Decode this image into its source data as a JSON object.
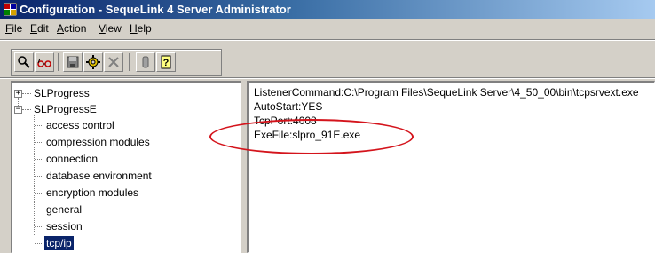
{
  "window": {
    "title": "Configuration - SequeLink 4 Server Administrator"
  },
  "menu": [
    {
      "label": "File",
      "accel": "F",
      "rest": "ile"
    },
    {
      "label": "Edit",
      "accel": "E",
      "rest": "dit"
    },
    {
      "label": "Action",
      "accel": "A",
      "rest": "ction"
    },
    {
      "label": "View",
      "accel": "V",
      "rest": "iew"
    },
    {
      "label": "Help",
      "accel": "H",
      "rest": "elp"
    }
  ],
  "toolbar": {
    "buttons": [
      "search-icon",
      "glasses-icon",
      "save-icon",
      "gear-icon",
      "delete-icon",
      "stop-icon",
      "help-icon"
    ]
  },
  "tree": {
    "nodes": [
      {
        "label": "SLProgress",
        "expander": "+"
      },
      {
        "label": "SLProgressE",
        "expander": "-"
      }
    ],
    "children": [
      {
        "label": "access control"
      },
      {
        "label": "compression modules"
      },
      {
        "label": "connection"
      },
      {
        "label": "database environment"
      },
      {
        "label": "encryption modules"
      },
      {
        "label": "general"
      },
      {
        "label": "session"
      },
      {
        "label": "tcp/ip",
        "selected": true
      }
    ]
  },
  "details": {
    "lines": [
      "ListenerCommand:C:\\Program Files\\SequeLink Server\\4_50_00\\bin\\tcpsrvext.exe",
      "AutoStart:YES",
      "TcpPort:4008",
      "ExeFile:slpro_91E.exe"
    ]
  },
  "colors": {
    "highlight_ellipse": "#d4141c",
    "selection": "#0a246a"
  }
}
